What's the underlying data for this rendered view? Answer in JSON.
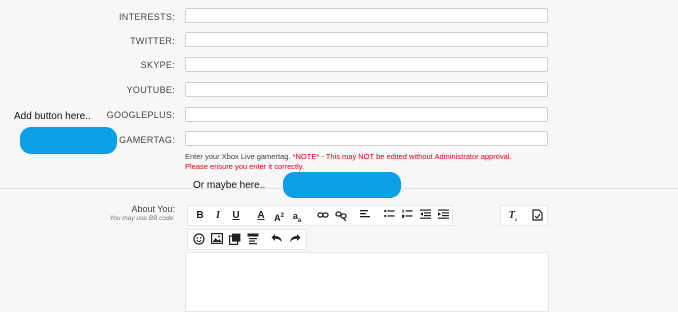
{
  "fields": [
    {
      "label": "INTERESTS:",
      "value": ""
    },
    {
      "label": "TWITTER:",
      "value": ""
    },
    {
      "label": "SKYPE:",
      "value": ""
    },
    {
      "label": "YOUTUBE:",
      "value": ""
    },
    {
      "label": "GOOGLEPLUS:",
      "value": ""
    },
    {
      "label": "GAMERTAG:",
      "value": ""
    }
  ],
  "gamertag_hint": {
    "text": "Enter your Xbox Live gamertag.",
    "warning_line1": "*NOTE* - This may NOT be edited without Administrator approval.",
    "warning_line2": "Please ensure you enter it correctly."
  },
  "annotations": {
    "add_button": "Add button here..",
    "or_maybe": "Or maybe here.."
  },
  "about": {
    "label": "About You:",
    "hint": "You may use BB code."
  },
  "toolbar": {
    "bold": "B",
    "italic": "I",
    "underline": "U",
    "font_color": "A",
    "font_size": "A",
    "font_family": "a",
    "remove_format": "T",
    "colors": {
      "accent": "#0a9fe6",
      "warning": "#e0001a"
    }
  }
}
